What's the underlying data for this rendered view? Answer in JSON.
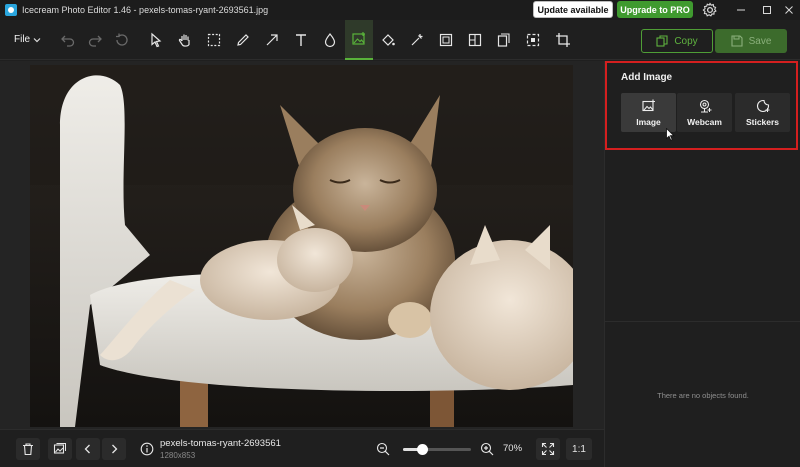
{
  "app": {
    "title": "Icecream Photo Editor 1.46 - pexels-tomas-ryant-2693561.jpg",
    "update_label": "Update available",
    "pro_label": "Upgrade to PRO"
  },
  "toolbar": {
    "file_label": "File",
    "tools": [
      "undo",
      "redo",
      "reset",
      "select",
      "hand",
      "marquee",
      "pencil",
      "arrow",
      "text",
      "blur",
      "add-image",
      "fill",
      "magic",
      "crop-frame",
      "collage",
      "add-page",
      "selection",
      "crop"
    ],
    "active_tool": "add-image",
    "copy_label": "Copy",
    "save_label": "Save"
  },
  "panel": {
    "title": "Add Image",
    "options": [
      {
        "label": "Image",
        "icon": "image-add-icon",
        "selected": true
      },
      {
        "label": "Webcam",
        "icon": "webcam-icon",
        "selected": false
      },
      {
        "label": "Stickers",
        "icon": "sticker-icon",
        "selected": false
      }
    ],
    "empty_text": "There are no objects found."
  },
  "bottom": {
    "file_name": "pexels-tomas-ryant-2693561",
    "dimensions": "1280x853",
    "zoom": "70%",
    "zoom_fraction": 0.28,
    "one_to_one": "1:1"
  },
  "colors": {
    "accent_green": "#59b33a",
    "highlight_red": "#d41f1f"
  }
}
